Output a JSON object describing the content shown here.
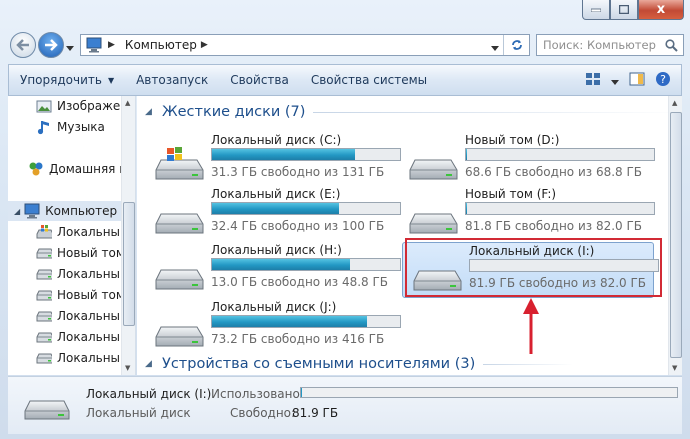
{
  "window": {
    "close_glyph": "x"
  },
  "address": {
    "crumb": "Компьютер",
    "search_placeholder": "Поиск: Компьютер"
  },
  "toolbar": {
    "organize": "Упорядочить",
    "autoplay": "Автозапуск",
    "properties": "Свойства",
    "system_properties": "Свойства системы"
  },
  "navpane": {
    "items": [
      {
        "label": "Изображен",
        "icon": "pictures-icon"
      },
      {
        "label": "Музыка",
        "icon": "music-icon"
      },
      {
        "label": "Домашняя гр",
        "icon": "homegroup-icon"
      },
      {
        "label": "Компьютер",
        "icon": "computer-icon"
      },
      {
        "label": "Локальный",
        "icon": "system-drive-icon"
      },
      {
        "label": "Новый том",
        "icon": "drive-icon"
      },
      {
        "label": "Локальный",
        "icon": "drive-icon"
      },
      {
        "label": "Новый том",
        "icon": "drive-icon"
      },
      {
        "label": "Локальный",
        "icon": "drive-icon"
      },
      {
        "label": "Локальный",
        "icon": "drive-icon"
      },
      {
        "label": "Локальный",
        "icon": "drive-icon"
      }
    ]
  },
  "groups": {
    "hard_drives": "Жесткие диски (7)",
    "removable": "Устройства со съемными носителями (3)"
  },
  "drives": [
    {
      "name": "Локальный диск (C:)",
      "free": "31.3 ГБ свободно из 131 ГБ",
      "used_fraction": 0.76,
      "system": true
    },
    {
      "name": "Новый том (D:)",
      "free": "68.6 ГБ свободно из 68.8 ГБ",
      "used_fraction": 0.003,
      "system": false
    },
    {
      "name": "Локальный диск (E:)",
      "free": "32.4 ГБ свободно из 100 ГБ",
      "used_fraction": 0.676,
      "system": false
    },
    {
      "name": "Новый том (F:)",
      "free": "81.8 ГБ свободно из 82.0 ГБ",
      "used_fraction": 0.003,
      "system": false
    },
    {
      "name": "Локальный диск (H:)",
      "free": "13.0 ГБ свободно из 48.8 ГБ",
      "used_fraction": 0.734,
      "system": false
    },
    {
      "name": "Локальный диск (I:)",
      "free": "81.9 ГБ свободно из 82.0 ГБ",
      "used_fraction": 0.002,
      "system": false,
      "selected": true
    },
    {
      "name": "Локальный диск (J:)",
      "free": "73.2 ГБ свободно из 416 ГБ",
      "used_fraction": 0.824,
      "system": false
    }
  ],
  "details": {
    "title": "Локальный диск (I:)",
    "type": "Локальный диск",
    "used_label": "Использовано:",
    "free_label": "Свободно:",
    "free_value": "81.9 ГБ",
    "used_fraction": 0.002
  },
  "colors": {
    "accent": "#1e4f8c",
    "bar_fill": "#2398c4",
    "highlight": "#d22a35"
  }
}
